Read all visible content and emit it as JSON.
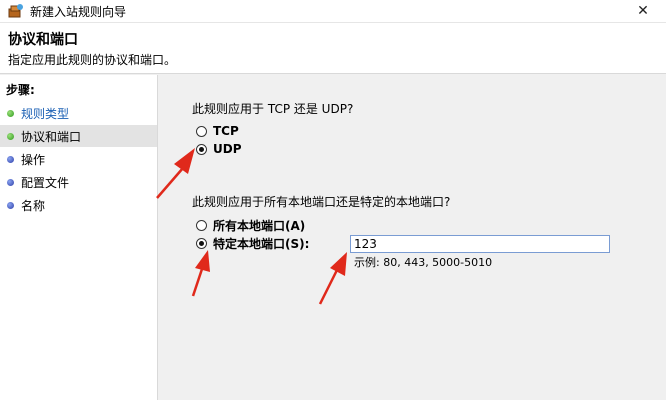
{
  "window": {
    "title": "新建入站规则向导"
  },
  "header": {
    "title": "协议和端口",
    "subtitle": "指定应用此规则的协议和端口。"
  },
  "steps": {
    "title": "步骤:",
    "items": [
      {
        "label": "规则类型",
        "state": "done"
      },
      {
        "label": "协议和端口",
        "state": "current"
      },
      {
        "label": "操作",
        "state": "todo"
      },
      {
        "label": "配置文件",
        "state": "todo"
      },
      {
        "label": "名称",
        "state": "todo"
      }
    ]
  },
  "protocol": {
    "question": "此规则应用于 TCP 还是 UDP?",
    "options": [
      {
        "label": "TCP",
        "selected": false
      },
      {
        "label": "UDP",
        "selected": true
      }
    ]
  },
  "ports": {
    "question": "此规则应用于所有本地端口还是特定的本地端口?",
    "options": [
      {
        "label": "所有本地端口(A)",
        "selected": false
      },
      {
        "label": "特定本地端口(S):",
        "selected": true
      }
    ],
    "value": "123",
    "example": "示例: 80, 443, 5000-5010"
  },
  "colors": {
    "annotation_arrow": "#e0291b",
    "step_done_dot": "#2f9a1e",
    "step_todo_dot": "#2e3fa8",
    "input_border": "#7a9cd3"
  },
  "icons": {
    "app": "firewall-wizard-icon",
    "close": "close-icon"
  }
}
